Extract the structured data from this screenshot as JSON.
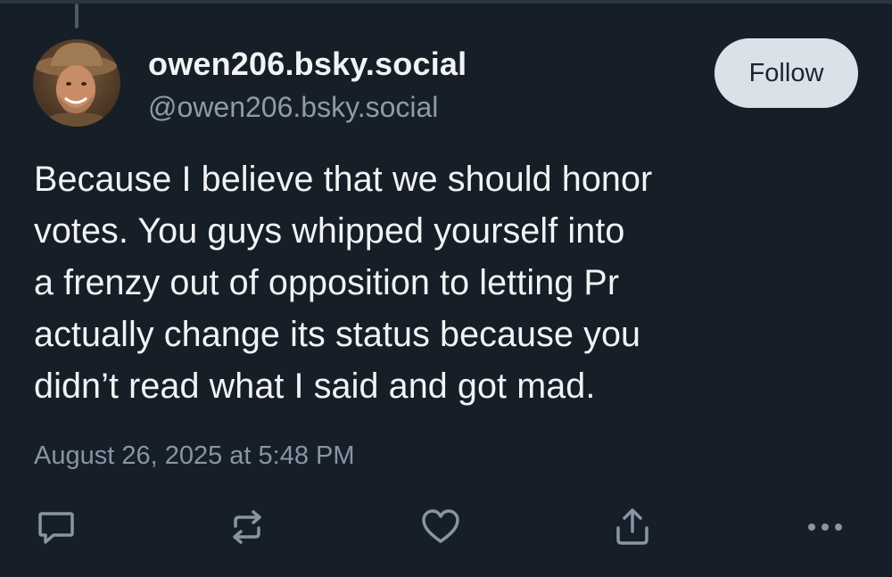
{
  "post": {
    "display_name": "owen206.bsky.social",
    "handle": "@owen206.bsky.social",
    "follow_label": "Follow",
    "text_lines": [
      "Because I believe that we should honor",
      "votes. You guys whipped yourself into",
      "a frenzy out of opposition to letting Pr",
      "actually change its status because you",
      "didn’t read what I said and got mad."
    ],
    "timestamp": "August 26, 2025 at 5:48 PM"
  },
  "actions": {
    "reply_icon": "reply-icon",
    "repost_icon": "repost-icon",
    "like_icon": "heart-icon",
    "share_icon": "share-icon",
    "more_icon": "more-icon"
  },
  "colors": {
    "background": "#161e27",
    "primary_text": "#f1f3f5",
    "secondary_text": "#8d9baa",
    "follow_button_bg": "#dbe1e9",
    "icon": "#8795a4"
  }
}
